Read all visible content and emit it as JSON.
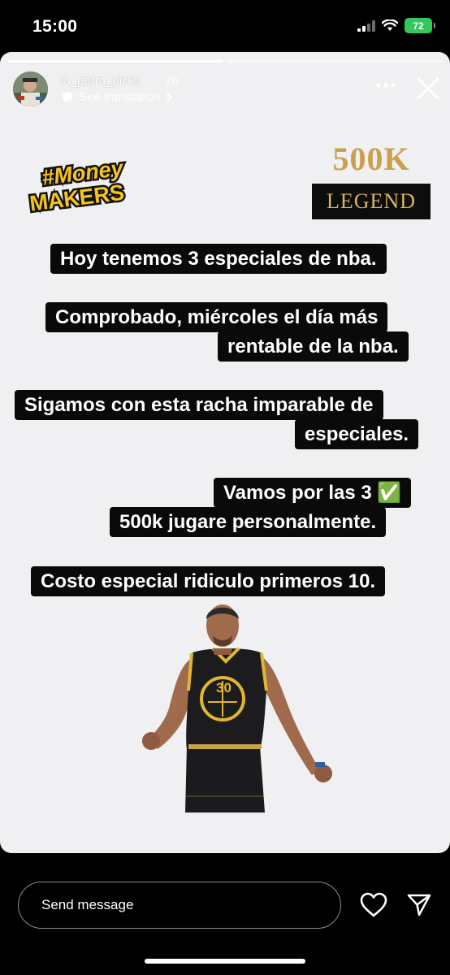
{
  "status_bar": {
    "time": "15:00",
    "battery": "72",
    "battery_color": "#34c759"
  },
  "story": {
    "user": {
      "username": "la_perra_picks",
      "time_ago": "7h",
      "translation_link": "See translation"
    },
    "logos": {
      "left_logo_line1": "#Money",
      "left_logo_line2": "MAKERS",
      "right_logo_top": "500K",
      "right_logo_bottom": "LEGEND"
    },
    "text_blocks": [
      {
        "lines": [
          "Hoy tenemos 3 especiales de nba."
        ]
      },
      {
        "lines": [
          "Comprobado, miércoles el día más",
          "rentable de la nba."
        ]
      },
      {
        "lines": [
          "Sigamos con esta racha imparable de",
          "especiales."
        ]
      },
      {
        "lines": [
          "Vamos por las 3 ✅",
          "500k jugare personalmente."
        ]
      },
      {
        "lines": [
          "Costo especial ridiculo primeros 10."
        ]
      }
    ],
    "player_jersey_number": "30",
    "progress_segments": 2,
    "active_segment": 1
  },
  "composer": {
    "placeholder": "Send message"
  },
  "icons": [
    "signal-icon",
    "wifi-icon",
    "battery-icon",
    "more-icon",
    "close-icon",
    "translate-icon",
    "chevron-right-icon",
    "heart-icon",
    "send-icon"
  ],
  "colors": {
    "story_bg": "#f0eff1",
    "text_block_bg": "#0a0a0a",
    "gold": "#c9a14d",
    "money_yellow": "#f7c41c"
  }
}
